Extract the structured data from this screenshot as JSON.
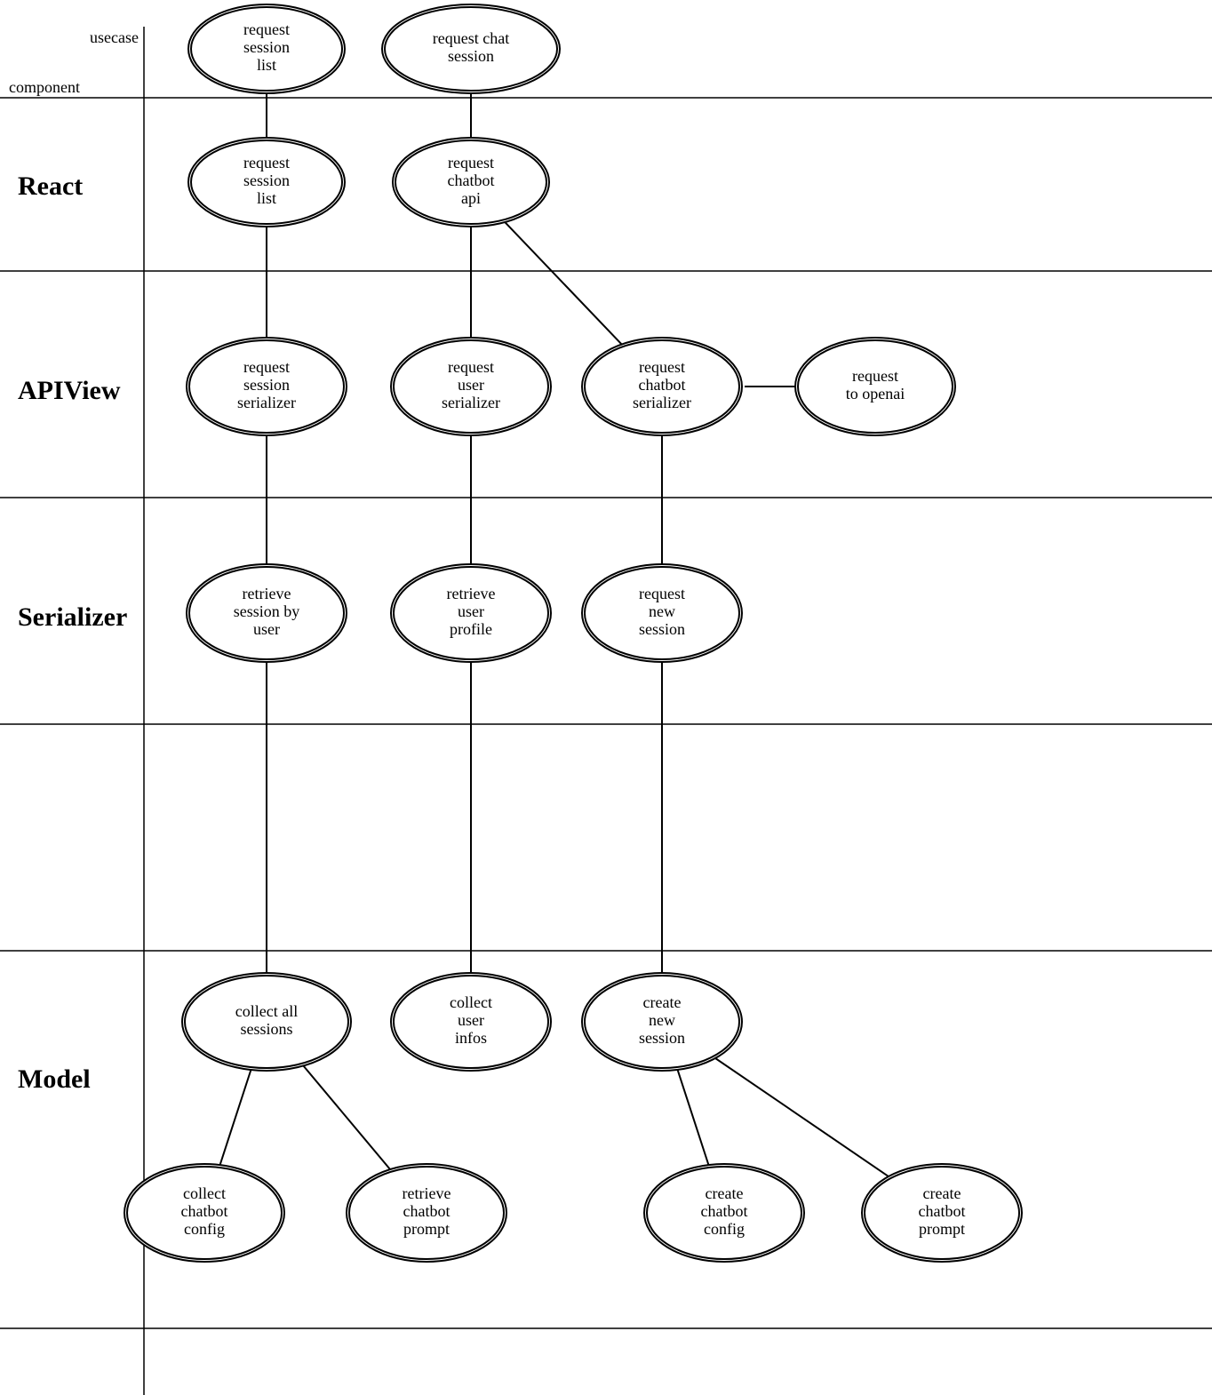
{
  "axes": {
    "x_label": "usecase",
    "y_label": "component"
  },
  "rows": [
    {
      "id": "react",
      "label": "React"
    },
    {
      "id": "apiview",
      "label": "APIView"
    },
    {
      "id": "serializer",
      "label": "Serializer"
    },
    {
      "id": "model",
      "label": "Model"
    }
  ],
  "nodes": {
    "uc_session_list": {
      "label": "request\nsession\nlist"
    },
    "uc_chat_session": {
      "label": "request chat\nsession"
    },
    "react_session": {
      "label": "request\nsession\nlist"
    },
    "react_chat": {
      "label": "request\nchatbot\napi"
    },
    "api_session": {
      "label": "request\nsession\nserializer"
    },
    "api_user": {
      "label": "request\nuser\nserializer"
    },
    "api_chatbot": {
      "label": "request\nchatbot\nserializer"
    },
    "api_openai": {
      "label": "request\nto openai"
    },
    "ser_session": {
      "label": "retrieve\nsession by\nuser"
    },
    "ser_user": {
      "label": "retrieve\nuser\nprofile"
    },
    "ser_new": {
      "label": "request\nnew\nsession"
    },
    "mod_sessions": {
      "label": "collect all\nsessions"
    },
    "mod_user": {
      "label": "collect\nuser\ninfos"
    },
    "mod_new": {
      "label": "create\nnew\nsession"
    },
    "mod_cfg_collect": {
      "label": "collect\nchatbot\nconfig"
    },
    "mod_prompt_ret": {
      "label": "retrieve\nchatbot\nprompt"
    },
    "mod_cfg_create": {
      "label": "create\nchatbot\nconfig"
    },
    "mod_prompt_create": {
      "label": "create\nchatbot\nprompt"
    }
  }
}
